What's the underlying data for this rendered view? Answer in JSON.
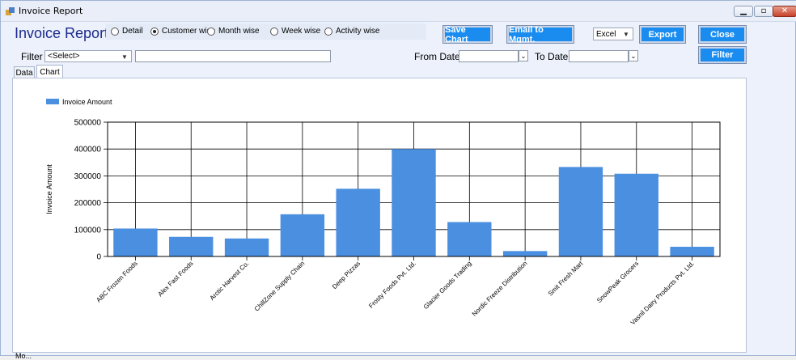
{
  "window": {
    "title": "Invoice Report"
  },
  "header": {
    "title": "Invoice Report"
  },
  "report_types": [
    {
      "label": "Detail",
      "selected": false
    },
    {
      "label": "Customer wise",
      "selected": true
    },
    {
      "label": "Month wise",
      "selected": false
    },
    {
      "label": "Week wise",
      "selected": false
    },
    {
      "label": "Activity wise",
      "selected": false
    }
  ],
  "toolbar": {
    "save_chart": "Save Chart",
    "email": "Email to Mgmt.",
    "export_format": "Excel",
    "export": "Export",
    "close": "Close",
    "filter": "Filter"
  },
  "filter": {
    "label": "Filter",
    "select_value": "<Select>",
    "text_value": "",
    "from_label": "From Date",
    "from_value": "",
    "to_label": "To Date",
    "to_value": ""
  },
  "tabs": [
    {
      "label": "Data",
      "active": false
    },
    {
      "label": "Chart",
      "active": true
    }
  ],
  "status_text": "Mo...",
  "colors": {
    "bar": "#4a8fe0",
    "button": "#1a8cf0",
    "heading": "#1c2a8c"
  },
  "chart_data": {
    "type": "bar",
    "ylabel": "Invoice Amount",
    "legend": "Invoice Amount",
    "legend_position": "top-left",
    "grid": true,
    "ylim": [
      0,
      500000
    ],
    "yticks": [
      0,
      100000,
      200000,
      300000,
      400000,
      500000
    ],
    "categories": [
      "ABC Frozen Foods",
      "Alex Fast Foods",
      "Arctic Harvest Co.",
      "ChillZone Supply Chain",
      "Deep Pizzas",
      "Frosty Foods Pvt. Ltd.",
      "Glacier Goods Trading",
      "Nordic Freeze Distribution",
      "Smit Fresh Mart",
      "SnowPeak Grocers",
      "Vasnil Dairy Products Pvt. Ltd."
    ],
    "values": [
      104000,
      73000,
      67000,
      157000,
      252000,
      400000,
      128000,
      20000,
      333000,
      308000,
      36000
    ]
  }
}
